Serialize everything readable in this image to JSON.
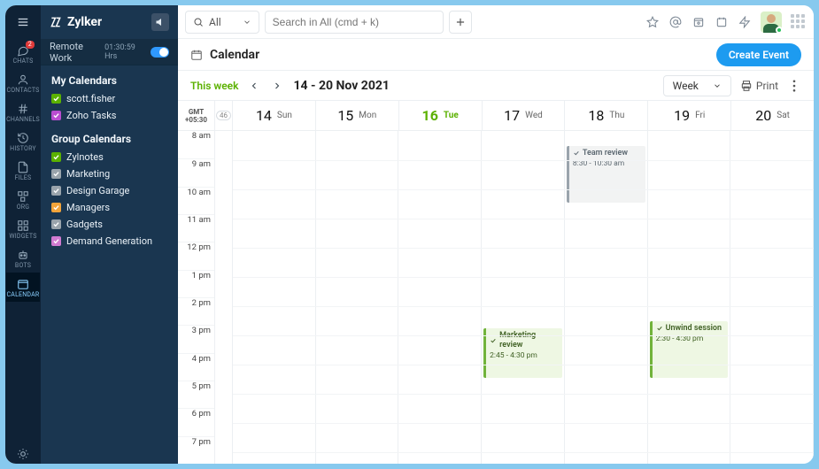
{
  "brand": {
    "name": "Zylker"
  },
  "remote": {
    "label": "Remote Work",
    "time": "01:30:59 Hrs"
  },
  "rail": {
    "items": [
      {
        "label": "CHATS",
        "icon": "chat",
        "badge": "2"
      },
      {
        "label": "CONTACTS",
        "icon": "contact"
      },
      {
        "label": "CHANNELS",
        "icon": "hash"
      },
      {
        "label": "HISTORY",
        "icon": "history"
      },
      {
        "label": "FILES",
        "icon": "file"
      },
      {
        "label": "ORG",
        "icon": "org"
      },
      {
        "label": "WIDGETS",
        "icon": "widgets"
      },
      {
        "label": "BOTS",
        "icon": "bot"
      },
      {
        "label": "CALENDAR",
        "icon": "calendar"
      }
    ]
  },
  "my_calendars": {
    "title": "My Calendars",
    "items": [
      {
        "label": "scott.fisher",
        "color": "#5bb100"
      },
      {
        "label": "Zoho Tasks",
        "color": "#b94dd1"
      }
    ]
  },
  "group_calendars": {
    "title": "Group Calendars",
    "items": [
      {
        "label": "Zylnotes",
        "color": "#5bb100"
      },
      {
        "label": "Marketing",
        "color": "#9aa4ac"
      },
      {
        "label": "Design Garage",
        "color": "#9aa4ac"
      },
      {
        "label": "Managers",
        "color": "#f2a43a"
      },
      {
        "label": "Gadgets",
        "color": "#9aa4ac"
      },
      {
        "label": "Demand Generation",
        "color": "#d17bd1"
      }
    ]
  },
  "topbar": {
    "scope": "All",
    "placeholder": "Search in All (cmd + k)"
  },
  "crumb": {
    "label": "Calendar",
    "create": "Create Event"
  },
  "range": {
    "thisweek": "This week",
    "text": "14 - 20 Nov 2021",
    "view": "Week",
    "print": "Print",
    "weeknum": "46",
    "tz1": "GMT",
    "tz2": "+05:30"
  },
  "days": [
    {
      "num": "14",
      "dow": "Sun"
    },
    {
      "num": "15",
      "dow": "Mon"
    },
    {
      "num": "16",
      "dow": "Tue",
      "today": true
    },
    {
      "num": "17",
      "dow": "Wed"
    },
    {
      "num": "18",
      "dow": "Thu"
    },
    {
      "num": "19",
      "dow": "Fri"
    },
    {
      "num": "20",
      "dow": "Sat"
    }
  ],
  "hours": [
    "8 am",
    "9 am",
    "10 am",
    "11 am",
    "12 pm",
    "1 pm",
    "2 pm",
    "3 pm",
    "4 pm",
    "5 pm",
    "6 pm",
    "7 pm"
  ],
  "events": [
    {
      "title": "Team review",
      "time": "8:30 - 10:30 am",
      "day": 4,
      "startHour": 8.5,
      "endHour": 10.5,
      "style": "done"
    },
    {
      "title": "Marketing review",
      "time": "2:45 - 4:30 pm",
      "day": 3,
      "startHour": 14.75,
      "endHour": 16.5,
      "style": "green"
    },
    {
      "title": "Unwind session",
      "time": "2:30 - 4:30 pm",
      "day": 5,
      "startHour": 14.5,
      "endHour": 16.5,
      "style": "green"
    }
  ]
}
